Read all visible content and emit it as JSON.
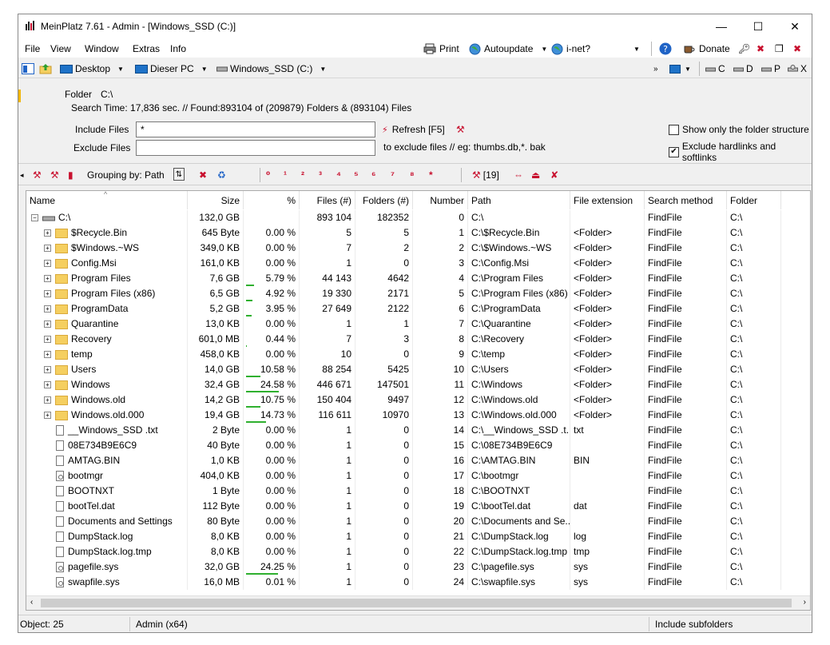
{
  "window": {
    "title": "MeinPlatz 7.61 - Admin - [Windows_SSD (C:)]",
    "minimize": "—",
    "maximize": "☐",
    "close": "✕"
  },
  "menu": {
    "file": "File",
    "view": "View",
    "window": "Window",
    "extras": "Extras",
    "info": "Info",
    "print": "Print",
    "autoupdate": "Autoupdate",
    "inet": "i-net?",
    "donate": "Donate"
  },
  "nav": {
    "desktop": "Desktop",
    "this_pc": "Dieser PC",
    "drive": "Windows_SSD (C:)",
    "drives": [
      "C",
      "D",
      "P",
      "X"
    ]
  },
  "panel": {
    "folder_label": "Folder",
    "folder_value": "C:\\",
    "search_time": "Search Time: 17,836 sec. //  Found:893104 of (209879) Folders & (893104) Files",
    "include_label": "Include Files",
    "include_value": "*",
    "exclude_label": "Exclude Files",
    "exclude_value": "",
    "refresh": "Refresh [F5]",
    "exclude_hint": "to exclude files // eg: thumbs.db,*. bak",
    "opt_structure": "Show only the folder structure",
    "opt_hardlinks": "Exclude hardlinks and softlinks"
  },
  "toolbar2": {
    "grouping": "Grouping by: Path",
    "count": "[19]"
  },
  "columns": {
    "name": "Name",
    "size": "Size",
    "percent": "%",
    "files": "Files (#)",
    "folders": "Folders (#)",
    "number": "Number",
    "path": "Path",
    "ext": "File extension",
    "method": "Search method",
    "folder": "Folder"
  },
  "rows": [
    {
      "type": "root",
      "name": "C:\\",
      "size": "132,0 GB",
      "pct": "",
      "pv": 0,
      "files": "893 104",
      "folders": "182352",
      "num": "0",
      "path": "C:\\",
      "ext": "",
      "method": "FindFile",
      "folder": "C:\\"
    },
    {
      "type": "folder",
      "name": "$Recycle.Bin",
      "size": "645 Byte",
      "pct": "0.00 %",
      "pv": 0,
      "files": "5",
      "folders": "5",
      "num": "1",
      "path": "C:\\$Recycle.Bin",
      "ext": "<Folder>",
      "method": "FindFile",
      "folder": "C:\\"
    },
    {
      "type": "folder",
      "name": "$Windows.~WS",
      "size": "349,0 KB",
      "pct": "0.00 %",
      "pv": 0,
      "files": "7",
      "folders": "2",
      "num": "2",
      "path": "C:\\$Windows.~WS",
      "ext": "<Folder>",
      "method": "FindFile",
      "folder": "C:\\"
    },
    {
      "type": "folder",
      "name": "Config.Msi",
      "size": "161,0 KB",
      "pct": "0.00 %",
      "pv": 0,
      "files": "1",
      "folders": "0",
      "num": "3",
      "path": "C:\\Config.Msi",
      "ext": "<Folder>",
      "method": "FindFile",
      "folder": "C:\\"
    },
    {
      "type": "folder",
      "name": "Program Files",
      "size": "7,6 GB",
      "pct": "5.79 %",
      "pv": 5.79,
      "files": "44 143",
      "folders": "4642",
      "num": "4",
      "path": "C:\\Program Files",
      "ext": "<Folder>",
      "method": "FindFile",
      "folder": "C:\\"
    },
    {
      "type": "folder",
      "name": "Program Files (x86)",
      "size": "6,5 GB",
      "pct": "4.92 %",
      "pv": 4.92,
      "files": "19 330",
      "folders": "2171",
      "num": "5",
      "path": "C:\\Program Files (x86)",
      "ext": "<Folder>",
      "method": "FindFile",
      "folder": "C:\\"
    },
    {
      "type": "folder",
      "name": "ProgramData",
      "size": "5,2 GB",
      "pct": "3.95 %",
      "pv": 3.95,
      "files": "27 649",
      "folders": "2122",
      "num": "6",
      "path": "C:\\ProgramData",
      "ext": "<Folder>",
      "method": "FindFile",
      "folder": "C:\\"
    },
    {
      "type": "folder",
      "name": "Quarantine",
      "size": "13,0 KB",
      "pct": "0.00 %",
      "pv": 0,
      "files": "1",
      "folders": "1",
      "num": "7",
      "path": "C:\\Quarantine",
      "ext": "<Folder>",
      "method": "FindFile",
      "folder": "C:\\"
    },
    {
      "type": "folder",
      "name": "Recovery",
      "size": "601,0 MB",
      "pct": "0.44 %",
      "pv": 0.44,
      "files": "7",
      "folders": "3",
      "num": "8",
      "path": "C:\\Recovery",
      "ext": "<Folder>",
      "method": "FindFile",
      "folder": "C:\\"
    },
    {
      "type": "folder",
      "name": "temp",
      "size": "458,0 KB",
      "pct": "0.00 %",
      "pv": 0,
      "files": "10",
      "folders": "0",
      "num": "9",
      "path": "C:\\temp",
      "ext": "<Folder>",
      "method": "FindFile",
      "folder": "C:\\"
    },
    {
      "type": "folder",
      "name": "Users",
      "size": "14,0 GB",
      "pct": "10.58 %",
      "pv": 10.58,
      "files": "88 254",
      "folders": "5425",
      "num": "10",
      "path": "C:\\Users",
      "ext": "<Folder>",
      "method": "FindFile",
      "folder": "C:\\"
    },
    {
      "type": "folder",
      "name": "Windows",
      "size": "32,4 GB",
      "pct": "24.58 %",
      "pv": 24.58,
      "files": "446 671",
      "folders": "147501",
      "num": "11",
      "path": "C:\\Windows",
      "ext": "<Folder>",
      "method": "FindFile",
      "folder": "C:\\"
    },
    {
      "type": "folder",
      "name": "Windows.old",
      "size": "14,2 GB",
      "pct": "10.75 %",
      "pv": 10.75,
      "files": "150 404",
      "folders": "9497",
      "num": "12",
      "path": "C:\\Windows.old",
      "ext": "<Folder>",
      "method": "FindFile",
      "folder": "C:\\"
    },
    {
      "type": "folder",
      "name": "Windows.old.000",
      "size": "19,4 GB",
      "pct": "14.73 %",
      "pv": 14.73,
      "files": "116 611",
      "folders": "10970",
      "num": "13",
      "path": "C:\\Windows.old.000",
      "ext": "<Folder>",
      "method": "FindFile",
      "folder": "C:\\"
    },
    {
      "type": "file",
      "name": "__Windows_SSD .txt",
      "size": "2 Byte",
      "pct": "0.00 %",
      "pv": 0,
      "files": "1",
      "folders": "0",
      "num": "14",
      "path": "C:\\__Windows_SSD .t...",
      "ext": "txt",
      "method": "FindFile",
      "folder": "C:\\"
    },
    {
      "type": "file",
      "name": "08E734B9E6C9",
      "size": "40 Byte",
      "pct": "0.00 %",
      "pv": 0,
      "files": "1",
      "folders": "0",
      "num": "15",
      "path": "C:\\08E734B9E6C9",
      "ext": "",
      "method": "FindFile",
      "folder": "C:\\"
    },
    {
      "type": "file",
      "name": "AMTAG.BIN",
      "size": "1,0 KB",
      "pct": "0.00 %",
      "pv": 0,
      "files": "1",
      "folders": "0",
      "num": "16",
      "path": "C:\\AMTAG.BIN",
      "ext": "BIN",
      "method": "FindFile",
      "folder": "C:\\"
    },
    {
      "type": "sys",
      "name": "bootmgr",
      "size": "404,0 KB",
      "pct": "0.00 %",
      "pv": 0,
      "files": "1",
      "folders": "0",
      "num": "17",
      "path": "C:\\bootmgr",
      "ext": "",
      "method": "FindFile",
      "folder": "C:\\"
    },
    {
      "type": "file",
      "name": "BOOTNXT",
      "size": "1 Byte",
      "pct": "0.00 %",
      "pv": 0,
      "files": "1",
      "folders": "0",
      "num": "18",
      "path": "C:\\BOOTNXT",
      "ext": "",
      "method": "FindFile",
      "folder": "C:\\"
    },
    {
      "type": "file",
      "name": "bootTel.dat",
      "size": "112 Byte",
      "pct": "0.00 %",
      "pv": 0,
      "files": "1",
      "folders": "0",
      "num": "19",
      "path": "C:\\bootTel.dat",
      "ext": "dat",
      "method": "FindFile",
      "folder": "C:\\"
    },
    {
      "type": "file",
      "name": "Documents and Settings",
      "size": "80 Byte",
      "pct": "0.00 %",
      "pv": 0,
      "files": "1",
      "folders": "0",
      "num": "20",
      "path": "C:\\Documents and Se...",
      "ext": "",
      "method": "FindFile",
      "folder": "C:\\"
    },
    {
      "type": "file",
      "name": "DumpStack.log",
      "size": "8,0 KB",
      "pct": "0.00 %",
      "pv": 0,
      "files": "1",
      "folders": "0",
      "num": "21",
      "path": "C:\\DumpStack.log",
      "ext": "log",
      "method": "FindFile",
      "folder": "C:\\"
    },
    {
      "type": "file",
      "name": "DumpStack.log.tmp",
      "size": "8,0 KB",
      "pct": "0.00 %",
      "pv": 0,
      "files": "1",
      "folders": "0",
      "num": "22",
      "path": "C:\\DumpStack.log.tmp",
      "ext": "tmp",
      "method": "FindFile",
      "folder": "C:\\"
    },
    {
      "type": "sys",
      "name": "pagefile.sys",
      "size": "32,0 GB",
      "pct": "24.25 %",
      "pv": 24.25,
      "files": "1",
      "folders": "0",
      "num": "23",
      "path": "C:\\pagefile.sys",
      "ext": "sys",
      "method": "FindFile",
      "folder": "C:\\"
    },
    {
      "type": "sys",
      "name": "swapfile.sys",
      "size": "16,0 MB",
      "pct": "0.01 %",
      "pv": 0.01,
      "files": "1",
      "folders": "0",
      "num": "24",
      "path": "C:\\swapfile.sys",
      "ext": "sys",
      "method": "FindFile",
      "folder": "C:\\"
    }
  ],
  "status": {
    "objects": "Object: 25",
    "user": "Admin (x64)",
    "mode": "Include subfolders"
  },
  "colors": {
    "bar": "#2fb02f",
    "folder": "#f5cf60",
    "accent_red": "#c8102e"
  }
}
